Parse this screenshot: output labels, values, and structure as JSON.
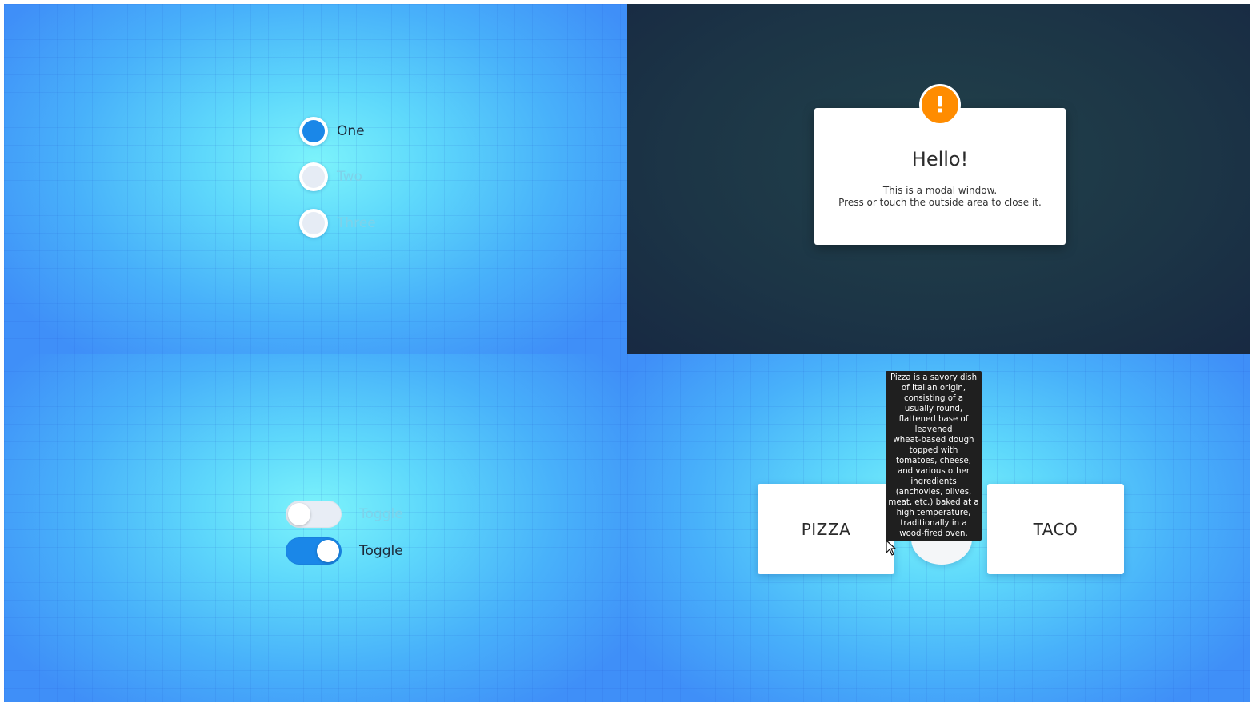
{
  "radios": {
    "options": [
      {
        "label": "One",
        "checked": true
      },
      {
        "label": "Two",
        "checked": false
      },
      {
        "label": "Three",
        "checked": false
      }
    ]
  },
  "modal": {
    "badge": "!",
    "title": "Hello!",
    "line1": "This is a modal window.",
    "line2": "Press or touch the outside area to close it."
  },
  "toggles": [
    {
      "label": "Toggle",
      "on": false
    },
    {
      "label": "Toggle",
      "on": true
    }
  ],
  "cards": {
    "left": "PIZZA",
    "right": "TACO",
    "tooltip_lines": [
      "Pizza is a savory dish",
      "of Italian origin,",
      "consisting of a",
      "usually round,",
      "flattened base of",
      "leavened",
      "wheat-based dough",
      "topped with",
      "tomatoes, cheese,",
      "and various other",
      "ingredients",
      "(anchovies, olives,",
      "meat, etc.) baked at a",
      "high temperature,",
      "traditionally in a",
      "wood-fired oven."
    ]
  },
  "colors": {
    "accent": "#1a87e8",
    "warning": "#ff8c00",
    "modal_backdrop": "#1c3546"
  }
}
